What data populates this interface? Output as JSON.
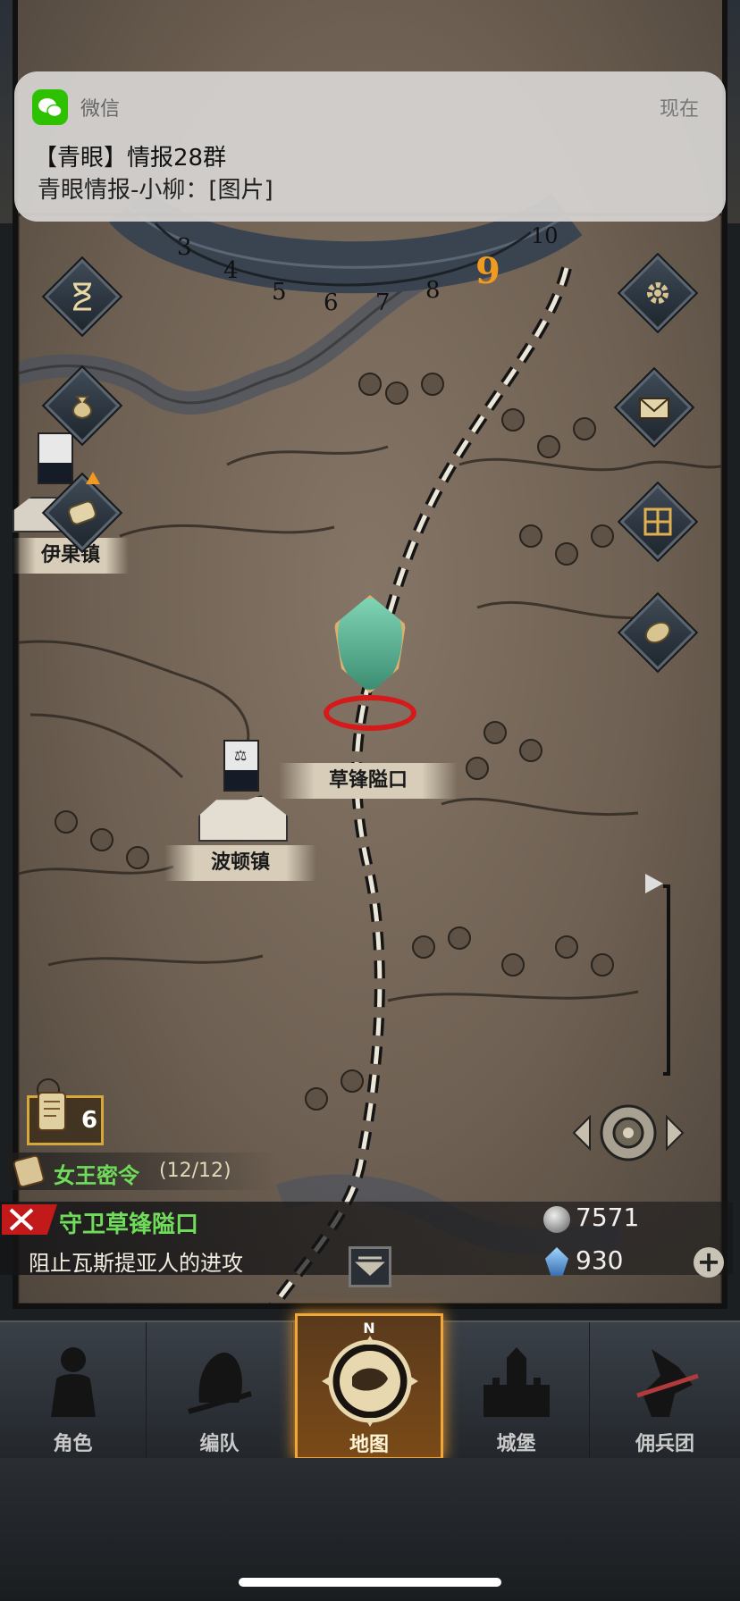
{
  "notification": {
    "app_name": "微信",
    "time": "现在",
    "title": "【青眼】情报28群",
    "body": "青眼情报-小柳：[图片]"
  },
  "clock": {
    "numbers": [
      "3",
      "4",
      "5",
      "6",
      "7",
      "8",
      "9",
      "10"
    ],
    "current": "9"
  },
  "map": {
    "locations": [
      {
        "name": "伊果镇"
      },
      {
        "name": "草锋隘口"
      },
      {
        "name": "波顿镇"
      }
    ]
  },
  "side_buttons_left": [
    "hourglass-icon",
    "money-bag-icon",
    "scroll-icon"
  ],
  "side_buttons_right": [
    "gear-icon",
    "mail-icon",
    "window-icon",
    "coin-icon"
  ],
  "quest": {
    "scroll_count": "6",
    "queen_order_label": "女王密令",
    "queen_order_count": "(12/12)",
    "title": "守卫草锋隘口",
    "description": "阻止瓦斯提亚人的进攻"
  },
  "resources": {
    "silver": "7571",
    "crystal": "930",
    "add": "+"
  },
  "nav": {
    "items": [
      {
        "label": "角色"
      },
      {
        "label": "编队"
      },
      {
        "label": "地图"
      },
      {
        "label": "城堡"
      },
      {
        "label": "佣兵团"
      }
    ],
    "compass_letter": "N"
  },
  "colors": {
    "quest_green": "#6fdc5a",
    "active_nav": "#f0a83a",
    "map_parchment": "#7a6c5e"
  }
}
